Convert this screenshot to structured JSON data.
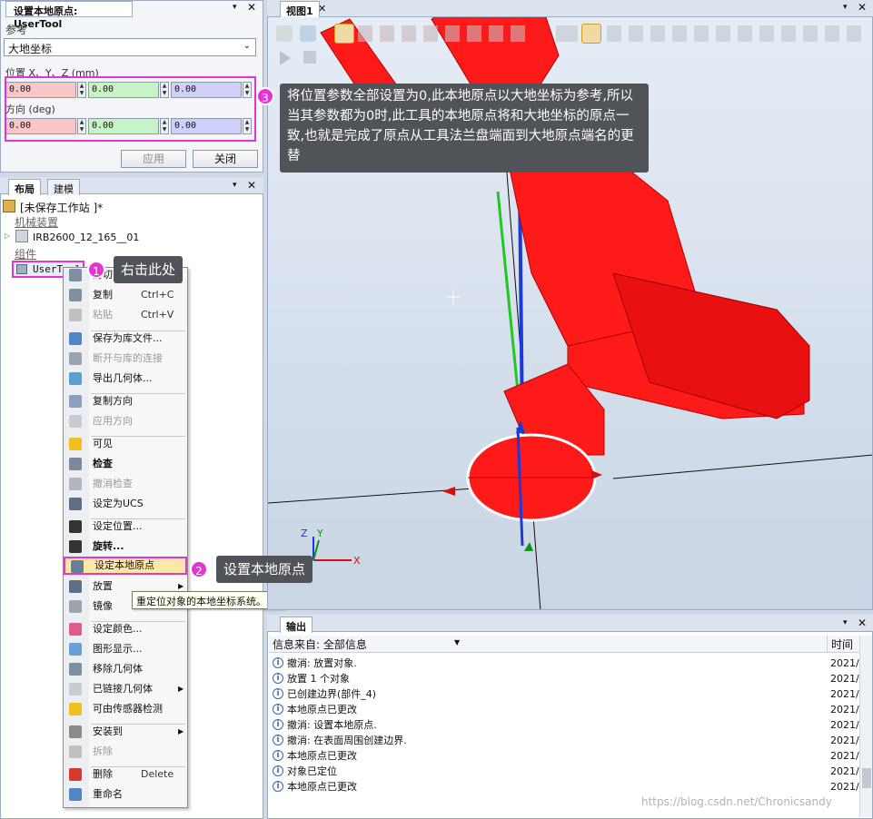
{
  "set_origin_panel": {
    "title": "设置本地原点: UserTool",
    "reference_label": "参考",
    "reference_value": "大地坐标",
    "position_label": "位置 X、Y、Z (mm)",
    "position_values": [
      "0.00",
      "0.00",
      "0.00"
    ],
    "orientation_label": "方向 (deg)",
    "orientation_values": [
      "0.00",
      "0.00",
      "0.00"
    ],
    "apply_label": "应用",
    "close_label": "关闭"
  },
  "layout_panel": {
    "tabs": [
      "布局",
      "建模"
    ],
    "station": "[未保存工作站 ]*",
    "mechanisms_label": "机械装置",
    "robot": "IRB2600_12_165__01",
    "components_label": "组件",
    "component": "UserTool"
  },
  "context_menu": {
    "items": [
      {
        "label": "剪切",
        "shortcut": "Ctrl+X",
        "disabled": false
      },
      {
        "label": "复制",
        "shortcut": "Ctrl+C",
        "disabled": false
      },
      {
        "label": "粘贴",
        "shortcut": "Ctrl+V",
        "disabled": true
      },
      {
        "label": "保存为库文件...",
        "shortcut": "",
        "disabled": false
      },
      {
        "label": "断开与库的连接",
        "shortcut": "",
        "disabled": true
      },
      {
        "label": "导出几何体...",
        "shortcut": "",
        "disabled": false
      },
      {
        "label": "复制方向",
        "shortcut": "",
        "disabled": false
      },
      {
        "label": "应用方向",
        "shortcut": "",
        "disabled": true
      },
      {
        "label": "可见",
        "shortcut": "",
        "disabled": false
      },
      {
        "label": "检查",
        "shortcut": "",
        "disabled": false
      },
      {
        "label": "撤消检查",
        "shortcut": "",
        "disabled": true
      },
      {
        "label": "设定为UCS",
        "shortcut": "",
        "disabled": false
      },
      {
        "label": "设定位置...",
        "shortcut": "",
        "disabled": false
      },
      {
        "label": "旋转...",
        "shortcut": "",
        "disabled": false
      },
      {
        "label": "设定本地原点",
        "shortcut": "",
        "disabled": false
      },
      {
        "label": "放置",
        "shortcut": "",
        "disabled": false
      },
      {
        "label": "镜像",
        "shortcut": "",
        "disabled": false
      },
      {
        "label": "设定颜色...",
        "shortcut": "",
        "disabled": false
      },
      {
        "label": "图形显示...",
        "shortcut": "",
        "disabled": false
      },
      {
        "label": "移除几何体",
        "shortcut": "",
        "disabled": false
      },
      {
        "label": "已链接几何体",
        "shortcut": "",
        "disabled": false
      },
      {
        "label": "可由传感器检测",
        "shortcut": "",
        "disabled": false
      },
      {
        "label": "安装到",
        "shortcut": "",
        "disabled": false
      },
      {
        "label": "拆除",
        "shortcut": "",
        "disabled": true
      },
      {
        "label": "删除",
        "shortcut": "Delete",
        "disabled": false
      },
      {
        "label": "重命名",
        "shortcut": "",
        "disabled": false
      }
    ],
    "tooltip": "重定位对象的本地坐标系统。"
  },
  "view": {
    "tab": "视图1"
  },
  "output": {
    "tab": "输出",
    "source_label": "信息来自: 全部信息",
    "time_header": "时间",
    "rows": [
      {
        "msg": "撤消:  放置对象.",
        "time": "2021/"
      },
      {
        "msg": "放置 1 个对象",
        "time": "2021/"
      },
      {
        "msg": "已创建边界(部件_4)",
        "time": "2021/"
      },
      {
        "msg": "本地原点已更改",
        "time": "2021/"
      },
      {
        "msg": "撤消:  设置本地原点.",
        "time": "2021/"
      },
      {
        "msg": "撤消:  在表面周围创建边界.",
        "time": "2021/"
      },
      {
        "msg": "本地原点已更改",
        "time": "2021/"
      },
      {
        "msg": "对象已定位",
        "time": "2021/"
      },
      {
        "msg": "本地原点已更改",
        "time": "2021/"
      }
    ]
  },
  "annotations": {
    "step1": "右击此处",
    "step2": "设置本地原点",
    "step3": "将位置参数全部设置为0,此本地原点以大地坐标为参考,所以当其参数都为0时,此工具的本地原点将和大地坐标的原点一致,也就是完成了原点从工具法兰盘端面到大地原点端名的更替",
    "num1": "1",
    "num2": "2",
    "num3": "3"
  },
  "watermark": "https://blog.csdn.net/Chronicsandy",
  "colors": {
    "accent_magenta": "#e534d6",
    "robot_red": "#ff1a1a",
    "panel_bg": "#f3f5f9"
  }
}
